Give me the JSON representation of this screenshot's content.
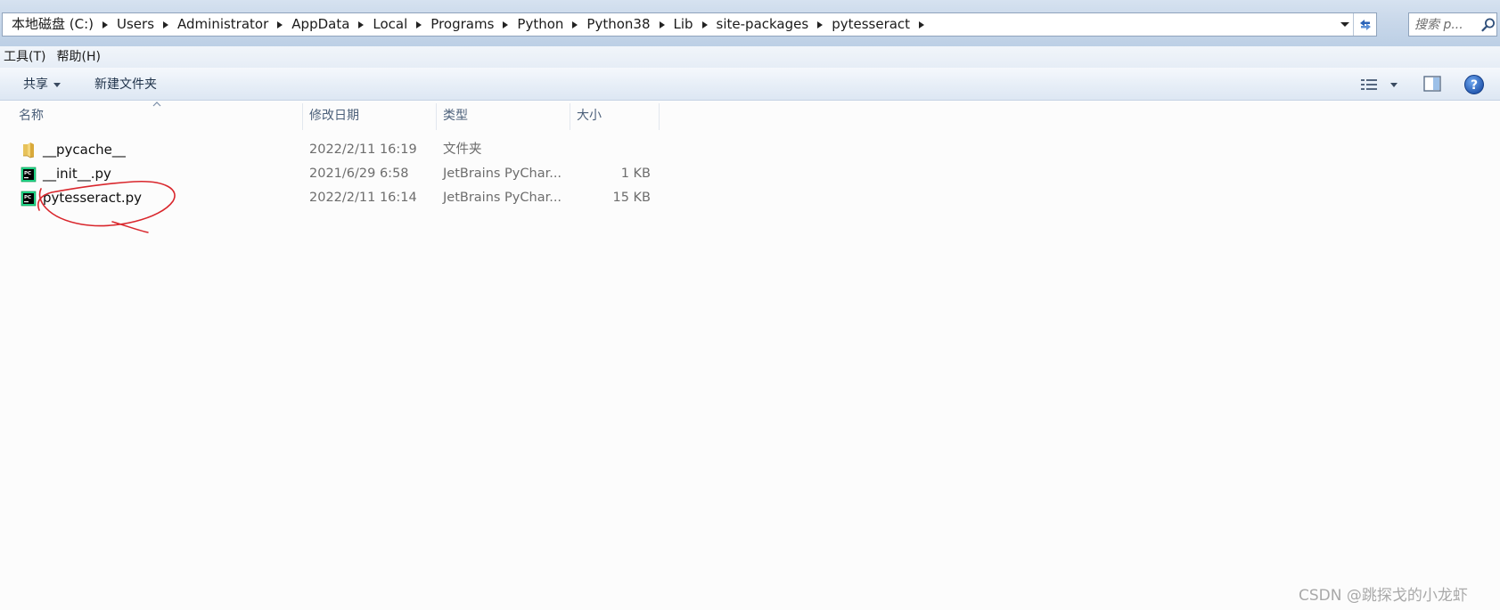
{
  "address_bar": {
    "crumbs": [
      "本地磁盘 (C:)",
      "Users",
      "Administrator",
      "AppData",
      "Local",
      "Programs",
      "Python",
      "Python38",
      "Lib",
      "site-packages",
      "pytesseract"
    ]
  },
  "search": {
    "placeholder": "搜索 p..."
  },
  "menu": {
    "items": [
      "工具(T)",
      "帮助(H)"
    ]
  },
  "toolbar": {
    "share_label": "共享",
    "new_folder_label": "新建文件夹"
  },
  "columns": {
    "name": "名称",
    "date": "修改日期",
    "type": "类型",
    "size": "大小"
  },
  "files": [
    {
      "name": "__pycache__",
      "date": "2022/2/11 16:19",
      "type": "文件夹",
      "size": "",
      "icon": "folder-icon"
    },
    {
      "name": "__init__.py",
      "date": "2021/6/29 6:58",
      "type": "JetBrains PyChar...",
      "size": "1 KB",
      "icon": "pycharm-file-icon"
    },
    {
      "name": "pytesseract.py",
      "date": "2022/2/11 16:14",
      "type": "JetBrains PyChar...",
      "size": "15 KB",
      "icon": "pycharm-file-icon"
    }
  ],
  "annotation": {
    "color": "#d9262c",
    "circled_item": "pytesseract.py"
  },
  "watermark": "CSDN @跳探戈的小龙虾",
  "colors": {
    "accent": "#2a63b8",
    "toolbar_gradient_top": "#f5f8fc",
    "toolbar_gradient_bottom": "#dde7f3"
  }
}
